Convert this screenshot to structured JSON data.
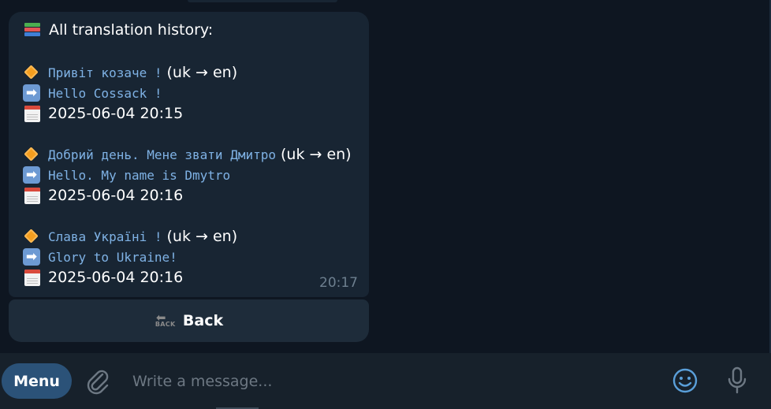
{
  "message": {
    "header": "All translation history:",
    "header_icon": "books-icon",
    "entries": [
      {
        "source": "Привіт козаче !",
        "direction": "(uk → en)",
        "translation": "Hello Cossack !",
        "datetime": "2025-06-04 20:15"
      },
      {
        "source": "Добрий день. Мене звати Дмитро",
        "direction": "(uk → en)",
        "translation": "Hello. My name is Dmytro",
        "datetime": "2025-06-04 20:16"
      },
      {
        "source": "Слава Україні !",
        "direction": "(uk → en)",
        "translation": "Glory to Ukraine!",
        "datetime": "2025-06-04 20:16"
      }
    ],
    "time": "20:17"
  },
  "keyboard": {
    "back_label": "Back",
    "back_icon_text": "BACK"
  },
  "input_bar": {
    "menu_label": "Menu",
    "placeholder": "Write a message..."
  },
  "colors": {
    "background": "#0e1621",
    "bubble": "#182533",
    "menu_button": "#2b5278",
    "code_text": "#7fb2e5",
    "icon_blue": "#5a9fd9"
  }
}
